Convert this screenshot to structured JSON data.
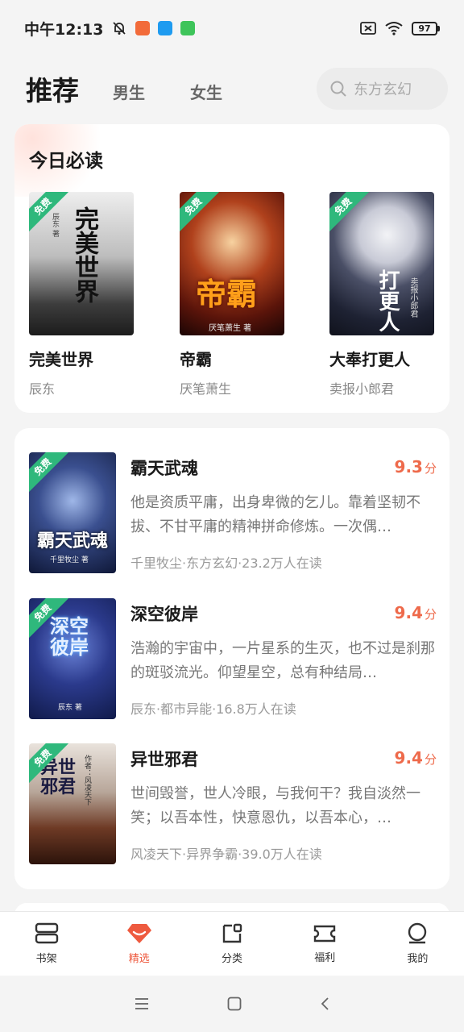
{
  "status_bar": {
    "time": "中午12:13",
    "battery": "97"
  },
  "header": {
    "tabs": [
      {
        "label": "推荐",
        "active": true
      },
      {
        "label": "男生",
        "active": false
      },
      {
        "label": "女生",
        "active": false
      }
    ],
    "search_placeholder": "东方玄幻"
  },
  "today": {
    "title": "今日必读",
    "free_badge": "免费",
    "books": [
      {
        "name": "完美世界",
        "author": "辰东",
        "cover_title": "完美世界",
        "cover_author": "辰东 著"
      },
      {
        "name": "帝霸",
        "author": "厌笔萧生",
        "cover_title": "帝霸",
        "cover_author": "厌笔萧生 著"
      },
      {
        "name": "大奉打更人",
        "author": "卖报小郎君",
        "cover_title": "打更人",
        "cover_author": "卖报小郎君"
      }
    ]
  },
  "recommend": {
    "free_badge": "免费",
    "score_unit": "分",
    "books": [
      {
        "title": "霸天武魂",
        "score": "9.3",
        "desc": "他是资质平庸，出身卑微的乞儿。靠着坚韧不拔、不甘平庸的精神拼命修炼。一次偶…",
        "meta": "千里牧尘·东方玄幻·23.2万人在读",
        "cover_title": "霸天武魂",
        "cover_author": "千里牧尘 著"
      },
      {
        "title": "深空彼岸",
        "score": "9.4",
        "desc": "浩瀚的宇宙中，一片星系的生灭，也不过是刹那的斑驳流光。仰望星空，总有种结局…",
        "meta": "辰东·都市异能·16.8万人在读",
        "cover_title": "深空彼岸",
        "cover_author": "辰东 著"
      },
      {
        "title": "异世邪君",
        "score": "9.4",
        "desc": "世间毁誉，世人冷眼，与我何干？我自淡然一笑；以吾本性，快意恩仇，以吾本心，…",
        "meta": "风凌天下·异界争霸·39.0万人在读",
        "cover_title": "异世邪君",
        "cover_author": "作者：风凌天下"
      }
    ]
  },
  "bottom_nav": [
    {
      "label": "书架",
      "icon": "bookshelf-icon",
      "active": false
    },
    {
      "label": "精选",
      "icon": "gem-icon",
      "active": true
    },
    {
      "label": "分类",
      "icon": "category-icon",
      "active": false
    },
    {
      "label": "福利",
      "icon": "ticket-icon",
      "active": false
    },
    {
      "label": "我的",
      "icon": "profile-icon",
      "active": false
    }
  ],
  "colors": {
    "accent": "#ee5a3f",
    "free_badge": "#2fb87c",
    "score": "#ee6a4b"
  }
}
